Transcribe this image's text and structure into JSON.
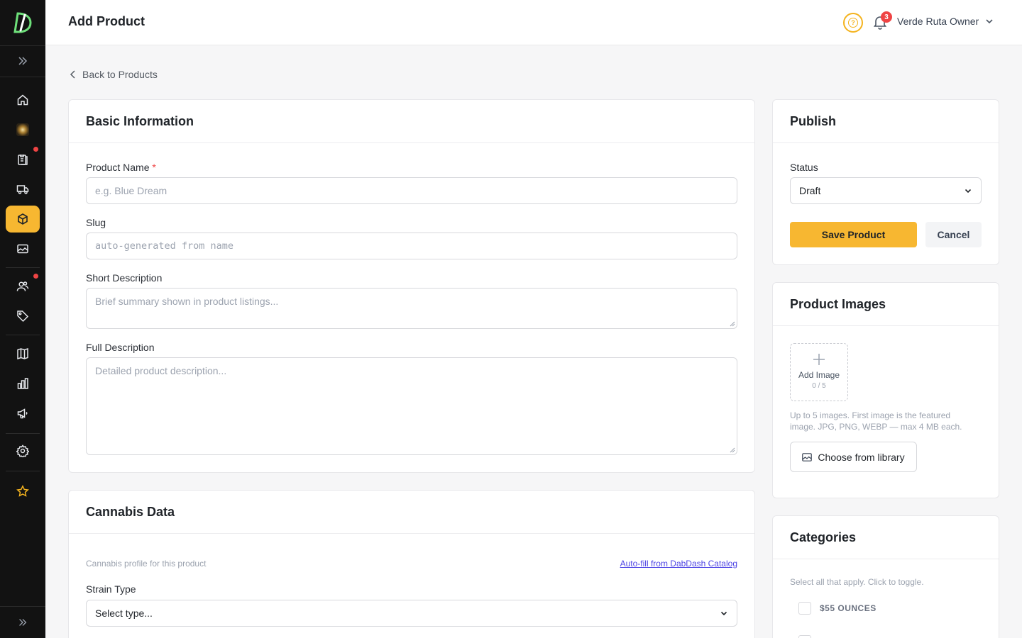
{
  "header": {
    "title": "Add Product",
    "help_icon": "?",
    "notification_count": "3",
    "user_name": "Verde Ruta Owner"
  },
  "nav": {
    "back_label": "Back to Products"
  },
  "basic_info": {
    "title": "Basic Information",
    "product_name_label": "Product Name",
    "required_mark": "*",
    "product_name_placeholder": "e.g. Blue Dream",
    "slug_label": "Slug",
    "slug_placeholder": "auto-generated from name",
    "short_desc_label": "Short Description",
    "short_desc_placeholder": "Brief summary shown in product listings...",
    "full_desc_label": "Full Description",
    "full_desc_placeholder": "Detailed product description..."
  },
  "cannabis": {
    "title": "Cannabis Data",
    "subtitle": "Cannabis profile for this product",
    "autofill_link": "Auto-fill from DabDash Catalog",
    "strain_label": "Strain Type",
    "strain_value": "Select type..."
  },
  "publish": {
    "title": "Publish",
    "status_label": "Status",
    "status_value": "Draft",
    "save_label": "Save Product",
    "cancel_label": "Cancel"
  },
  "images": {
    "title": "Product Images",
    "add_label": "Add Image",
    "count": "0 / 5",
    "hint_line1": "Up to 5 images. First image is the featured",
    "hint_line2": "image. JPG, PNG, WEBP — max 4 MB each.",
    "library_label": "Choose from library"
  },
  "categories": {
    "title": "Categories",
    "hint": "Select all that apply. Click to toggle.",
    "items": [
      {
        "label": "$55 OUNCES"
      }
    ]
  },
  "colors": {
    "sidebar": "#121212",
    "accent": "#f7b731",
    "link": "#4f46e5",
    "danger": "#ef4444"
  },
  "sidebar_icons": [
    "expand-icon",
    "home-icon",
    "store-photo-icon",
    "orders-icon",
    "delivery-icon",
    "products-icon",
    "media-icon",
    "customers-icon",
    "tags-icon",
    "catalog-icon",
    "analytics-icon",
    "marketing-icon",
    "settings-icon",
    "favorites-icon",
    "collapse-icon"
  ]
}
